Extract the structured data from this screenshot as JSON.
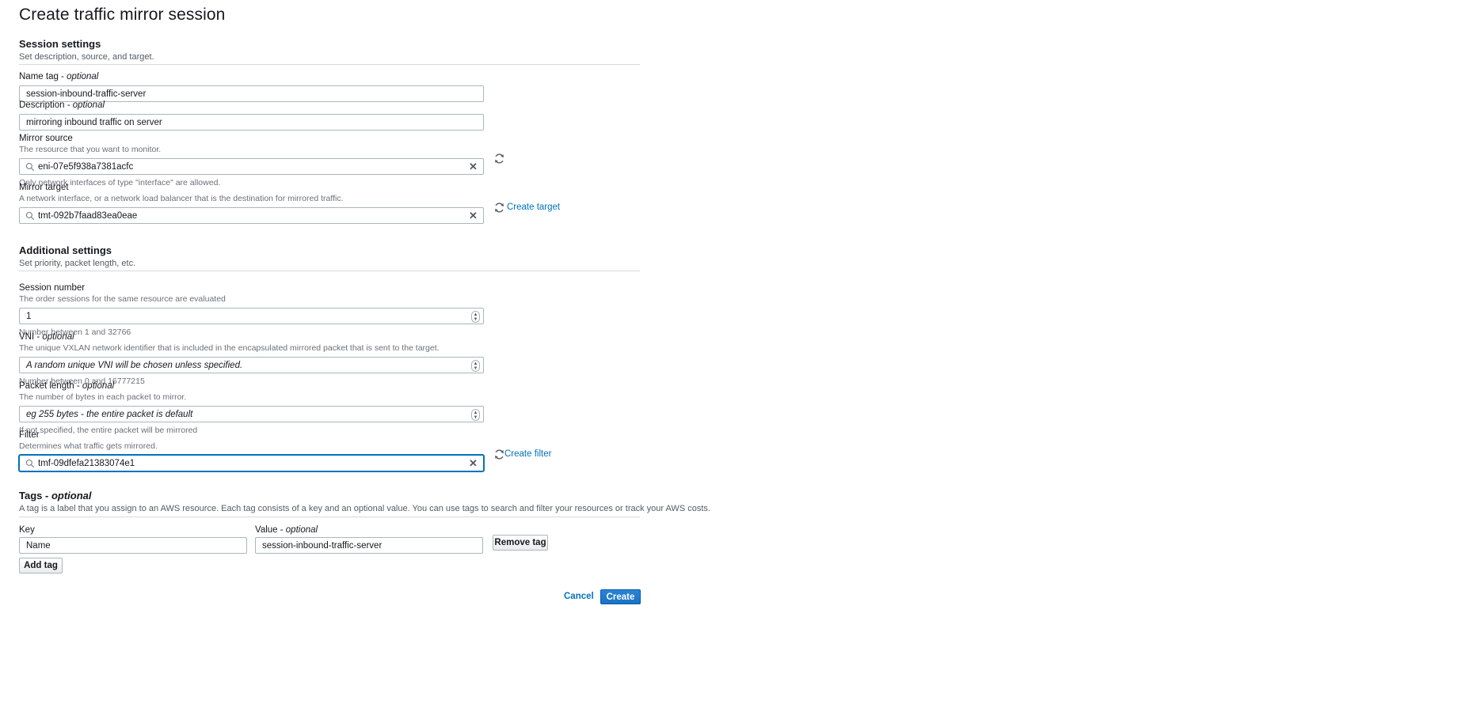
{
  "page": {
    "title": "Create traffic mirror session"
  },
  "session_settings": {
    "title": "Session settings",
    "subtitle": "Set description, source, and target.",
    "name_tag": {
      "label": "Name tag - ",
      "label_optional": "optional",
      "value": "session-inbound-traffic-server"
    },
    "description": {
      "label": "Description - ",
      "label_optional": "optional",
      "value": "mirroring inbound traffic on server"
    },
    "mirror_source": {
      "label": "Mirror source",
      "desc": "The resource that you want to monitor.",
      "value": "eni-07e5f938a7381acfc",
      "hint": "Only network interfaces of type \"interface\" are allowed."
    },
    "mirror_target": {
      "label": "Mirror target",
      "desc": "A network interface, or a network load balancer that is the destination for mirrored traffic.",
      "value": "tmt-092b7faad83ea0eae",
      "create_link": "Create target"
    }
  },
  "additional_settings": {
    "title": "Additional settings",
    "subtitle": "Set priority, packet length, etc.",
    "session_number": {
      "label": "Session number",
      "desc": "The order sessions for the same resource are evaluated",
      "value": "1",
      "hint": "Number between 1 and 32766"
    },
    "vni": {
      "label": "VNI - ",
      "label_optional": "optional",
      "desc": "The unique VXLAN network identifier that is included in the encapsulated mirrored packet that is sent to the target.",
      "placeholder": "A random unique VNI will be chosen unless specified.",
      "hint": "Number between 0 and 16777215"
    },
    "packet_length": {
      "label": "Packet length - ",
      "label_optional": "optional",
      "desc": "The number of bytes in each packet to mirror.",
      "placeholder": "eg 255 bytes - the entire packet is default",
      "hint": "If not specified, the entire packet will be mirrored"
    },
    "filter": {
      "label": "Filter",
      "desc": "Determines what traffic gets mirrored.",
      "value": "tmf-09dfefa21383074e1",
      "create_link": "Create filter"
    }
  },
  "tags": {
    "title": "Tags - ",
    "title_optional": "optional",
    "subtitle": "A tag is a label that you assign to an AWS resource. Each tag consists of a key and an optional value. You can use tags to search and filter your resources or track your AWS costs.",
    "key_label": "Key",
    "value_label": "Value - ",
    "value_label_optional": "optional",
    "rows": [
      {
        "key": "Name",
        "value": "session-inbound-traffic-server"
      }
    ],
    "remove_label": "Remove tag",
    "add_label": "Add tag"
  },
  "footer": {
    "cancel": "Cancel",
    "create": "Create"
  },
  "colors": {
    "link": "#0073bb",
    "primary": "#1a72c4",
    "focus": "#0073bb"
  }
}
